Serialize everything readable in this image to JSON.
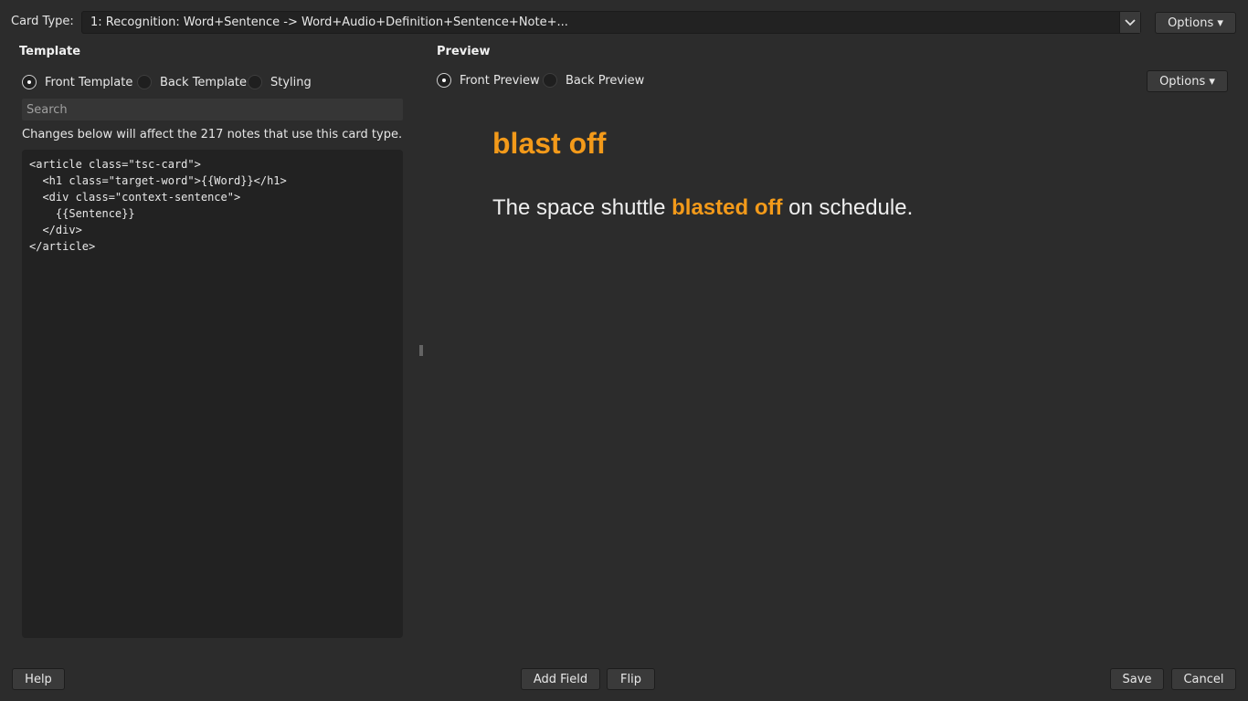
{
  "header": {
    "card_type_label": "Card Type:",
    "card_type_value": "1: Recognition: Word+Sentence -> Word+Audio+Definition+Sentence+Note+...",
    "options_label": "Options ▾"
  },
  "template": {
    "title": "Template",
    "radios": [
      {
        "label": "Front Template",
        "checked": true
      },
      {
        "label": "Back Template",
        "checked": false
      },
      {
        "label": "Styling",
        "checked": false
      }
    ],
    "search_placeholder": "Search",
    "info": "Changes below will affect the 217 notes that use this card type.",
    "code": "<article class=\"tsc-card\">\n  <h1 class=\"target-word\">{{Word}}</h1>\n  <div class=\"context-sentence\">\n    {{Sentence}}\n  </div>\n</article>"
  },
  "preview": {
    "title": "Preview",
    "radios": [
      {
        "label": "Front Preview",
        "checked": true
      },
      {
        "label": "Back Preview",
        "checked": false
      }
    ],
    "options_label": "Options ▾",
    "word": "blast off",
    "sentence_before": "The space shuttle ",
    "sentence_highlight": "blasted off",
    "sentence_after": " on schedule.",
    "highlight_color": "#f39a1a"
  },
  "footer": {
    "help": "Help",
    "add_field": "Add Field",
    "flip": "Flip",
    "save": "Save",
    "cancel": "Cancel"
  }
}
